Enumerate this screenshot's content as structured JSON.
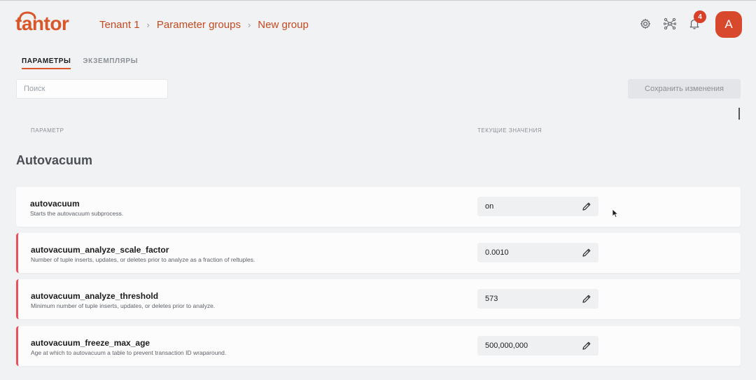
{
  "brand": {
    "logo_text": "tantor"
  },
  "breadcrumb": [
    "Tenant 1",
    "Parameter groups",
    "New group"
  ],
  "header": {
    "icons": [
      "gear-icon",
      "cluster-icon",
      "bell-icon"
    ],
    "notification_count": "4",
    "avatar_letter": "A"
  },
  "tabs": [
    {
      "label": "ПАРАМЕТРЫ",
      "active": true
    },
    {
      "label": "ЭКЗЕМПЛЯРЫ",
      "active": false
    }
  ],
  "search": {
    "placeholder": "Поиск"
  },
  "save_button": {
    "label": "Сохранить изменения"
  },
  "columns": {
    "param": "ПАРАМЕТР",
    "values": "ТЕКУЩИЕ ЗНАЧЕНИЯ"
  },
  "section": {
    "title": "Autovacuum"
  },
  "params": [
    {
      "name": "autovacuum",
      "description": "Starts the autovacuum subprocess.",
      "value": "on",
      "modified": false
    },
    {
      "name": "autovacuum_analyze_scale_factor",
      "description": "Number of tuple inserts, updates, or deletes prior to analyze as a fraction of reltuples.",
      "value": "0.0010",
      "modified": true
    },
    {
      "name": "autovacuum_analyze_threshold",
      "description": "Minimum number of tuple inserts, updates, or deletes prior to analyze.",
      "value": "573",
      "modified": true
    },
    {
      "name": "autovacuum_freeze_max_age",
      "description": "Age at which to autovacuum a table to prevent transaction ID wraparound.",
      "value": "500,000,000",
      "modified": true
    }
  ],
  "colors": {
    "accent": "#d8562a",
    "modified_marker": "#e8525e",
    "badge": "#d8402a"
  }
}
